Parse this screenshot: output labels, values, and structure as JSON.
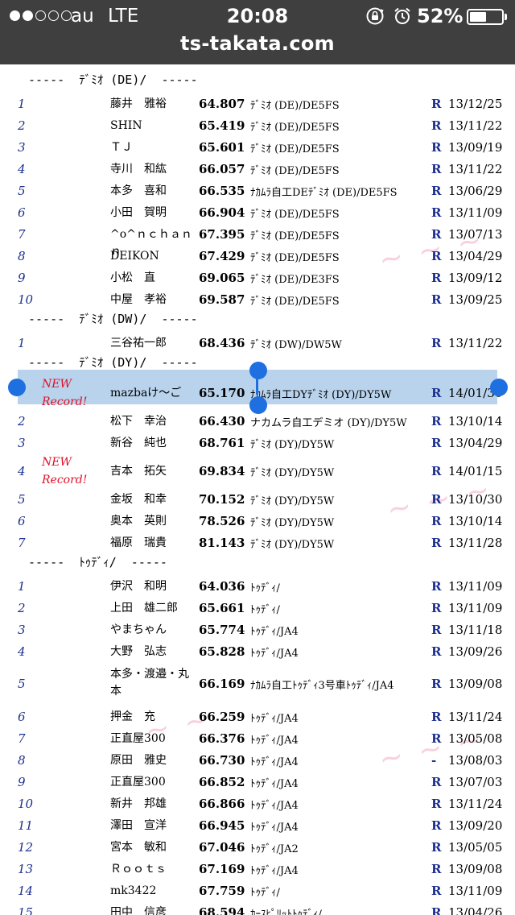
{
  "status_bar": {
    "carrier": "au",
    "network": "LTE",
    "time": "20:08",
    "battery_percent": "52%",
    "battery_level": 0.52,
    "signal_bars_filled": 2,
    "signal_bars_total": 5,
    "icons": [
      "rotation-lock-icon",
      "alarm-icon"
    ]
  },
  "browser": {
    "url": "ts-takata.com"
  },
  "new_record_label": "NEW\nRecord!",
  "colors": {
    "rank": "#1c2f8e",
    "new_record": "#e0102a",
    "selection": "#b9d3ec",
    "handle": "#1e6fe0"
  },
  "sections": [
    {
      "header": "-----  ﾃﾞﾐｵ (DE)/  -----",
      "rows": [
        {
          "rank": "1",
          "name": "藤井　雅裕",
          "time": "64.807",
          "car": "ﾃﾞﾐｵ (DE)/DE5FS",
          "flag": "R",
          "date": "13/12/25"
        },
        {
          "rank": "2",
          "name": "SHIN",
          "time": "65.419",
          "car": "ﾃﾞﾐｵ (DE)/DE5FS",
          "flag": "R",
          "date": "13/11/22"
        },
        {
          "rank": "3",
          "name": "ＴＪ",
          "time": "65.601",
          "car": "ﾃﾞﾐｵ (DE)/DE5FS",
          "flag": "R",
          "date": "13/09/19"
        },
        {
          "rank": "4",
          "name": "寺川　和紘",
          "time": "66.057",
          "car": "ﾃﾞﾐｵ (DE)/DE5FS",
          "flag": "R",
          "date": "13/11/22"
        },
        {
          "rank": "5",
          "name": "本多　喜和",
          "time": "66.535",
          "car": "ﾅｶﾑﾗ自工DEﾃﾞﾐｵ (DE)/DE5FS",
          "flag": "R",
          "date": "13/06/29"
        },
        {
          "rank": "6",
          "name": "小田　賀明",
          "time": "66.904",
          "car": "ﾃﾞﾐｵ (DE)/DE5FS",
          "flag": "R",
          "date": "13/11/09"
        },
        {
          "rank": "7",
          "name": "^o^ｎｃｈａｎｎ",
          "time": "67.395",
          "car": "ﾃﾞﾐｵ (DE)/DE5FS",
          "flag": "R",
          "date": "13/07/13"
        },
        {
          "rank": "8",
          "name": "DEIKON",
          "time": "67.429",
          "car": "ﾃﾞﾐｵ (DE)/DE5FS",
          "flag": "R",
          "date": "13/04/29"
        },
        {
          "rank": "9",
          "name": "小松　直",
          "time": "69.065",
          "car": "ﾃﾞﾐｵ (DE)/DE3FS",
          "flag": "R",
          "date": "13/09/12"
        },
        {
          "rank": "10",
          "name": "中屋　孝裕",
          "time": "69.587",
          "car": "ﾃﾞﾐｵ (DE)/DE5FS",
          "flag": "R",
          "date": "13/09/25"
        }
      ]
    },
    {
      "header": "-----  ﾃﾞﾐｵ (DW)/  -----",
      "rows": [
        {
          "rank": "1",
          "name": "三谷祐一郎",
          "time": "68.436",
          "car": "ﾃﾞﾐｵ (DW)/DW5W",
          "flag": "R",
          "date": "13/11/22"
        }
      ]
    },
    {
      "header": "-----  ﾃﾞﾐｵ (DY)/  -----",
      "rows": [
        {
          "rank": "",
          "name": "mazbaけ〜ご",
          "time": "65.170",
          "car": "ﾅｶﾑﾗ自工DYﾃﾞﾐｵ (DY)/DY5W",
          "flag": "R",
          "date": "14/01/30",
          "new_record": true,
          "selected": true
        },
        {
          "rank": "2",
          "name": "松下　幸治",
          "time": "66.430",
          "car": "ナカムラ自工デミオ (DY)/DY5W",
          "flag": "R",
          "date": "13/10/14"
        },
        {
          "rank": "3",
          "name": "新谷　純也",
          "time": "68.761",
          "car": "ﾃﾞﾐｵ (DY)/DY5W",
          "flag": "R",
          "date": "13/04/29"
        },
        {
          "rank": "4",
          "name": "吉本　拓矢",
          "time": "69.834",
          "car": "ﾃﾞﾐｵ (DY)/DY5W",
          "flag": "R",
          "date": "14/01/15",
          "new_record": true
        },
        {
          "rank": "5",
          "name": "金坂　和幸",
          "time": "70.152",
          "car": "ﾃﾞﾐｵ (DY)/DY5W",
          "flag": "R",
          "date": "13/10/30"
        },
        {
          "rank": "6",
          "name": "奥本　英則",
          "time": "78.526",
          "car": "ﾃﾞﾐｵ (DY)/DY5W",
          "flag": "R",
          "date": "13/10/14"
        },
        {
          "rank": "7",
          "name": "福原　瑞貴",
          "time": "81.143",
          "car": "ﾃﾞﾐｵ (DY)/DY5W",
          "flag": "R",
          "date": "13/11/28"
        }
      ]
    },
    {
      "header": "-----  ﾄｩﾃﾞｨ/  -----",
      "rows": [
        {
          "rank": "1",
          "name": "伊沢　和明",
          "time": "64.036",
          "car": "ﾄｩﾃﾞｨ/",
          "flag": "R",
          "date": "13/11/09"
        },
        {
          "rank": "2",
          "name": "上田　雄二郎",
          "time": "65.661",
          "car": "ﾄｩﾃﾞｨ/",
          "flag": "R",
          "date": "13/11/09"
        },
        {
          "rank": "3",
          "name": "やまちゃん",
          "time": "65.774",
          "car": "ﾄｩﾃﾞｨ/JA4",
          "flag": "R",
          "date": "13/11/18"
        },
        {
          "rank": "4",
          "name": "大野　弘志",
          "time": "65.828",
          "car": "ﾄｩﾃﾞｨ/JA4",
          "flag": "R",
          "date": "13/09/26"
        },
        {
          "rank": "5",
          "name": "本多・渡邉・丸本",
          "time": "66.169",
          "car": "ﾅｶﾑﾗ自工ﾄｩﾃﾞｨ3号車ﾄｩﾃﾞｨ/JA4",
          "flag": "R",
          "date": "13/09/08",
          "tall": true
        },
        {
          "rank": "6",
          "name": "押金　充",
          "time": "66.259",
          "car": "ﾄｩﾃﾞｨ/JA4",
          "flag": "R",
          "date": "13/11/24"
        },
        {
          "rank": "7",
          "name": "正直屋300",
          "time": "66.376",
          "car": "ﾄｩﾃﾞｨ/JA4",
          "flag": "R",
          "date": "13/05/08"
        },
        {
          "rank": "8",
          "name": "原田　雅史",
          "time": "66.730",
          "car": "ﾄｩﾃﾞｨ/JA4",
          "flag": "-",
          "date": "13/08/03"
        },
        {
          "rank": "9",
          "name": "正直屋300",
          "time": "66.852",
          "car": "ﾄｩﾃﾞｨ/JA4",
          "flag": "R",
          "date": "13/07/03"
        },
        {
          "rank": "10",
          "name": "新井　邦雄",
          "time": "66.866",
          "car": "ﾄｩﾃﾞｨ/JA4",
          "flag": "R",
          "date": "13/11/24"
        },
        {
          "rank": "11",
          "name": "澤田　宣洋",
          "time": "66.945",
          "car": "ﾄｩﾃﾞｨ/JA4",
          "flag": "R",
          "date": "13/09/20"
        },
        {
          "rank": "12",
          "name": "宮本　敏和",
          "time": "67.046",
          "car": "ﾄｩﾃﾞｨ/JA2",
          "flag": "R",
          "date": "13/05/05"
        },
        {
          "rank": "13",
          "name": "Ｒｏｏｔｓ",
          "time": "67.169",
          "car": "ﾄｩﾃﾞｨ/JA4",
          "flag": "R",
          "date": "13/09/08"
        },
        {
          "rank": "14",
          "name": "mk3422",
          "time": "67.759",
          "car": "ﾄｩﾃﾞｨ/",
          "flag": "R",
          "date": "13/11/09"
        },
        {
          "rank": "15",
          "name": "田中　信彦",
          "time": "68.594",
          "car": "ｶｰｽﾋﾟﾘｯﾄﾄｩﾃﾞｨ/",
          "flag": "R",
          "date": "13/04/26"
        }
      ]
    }
  ]
}
